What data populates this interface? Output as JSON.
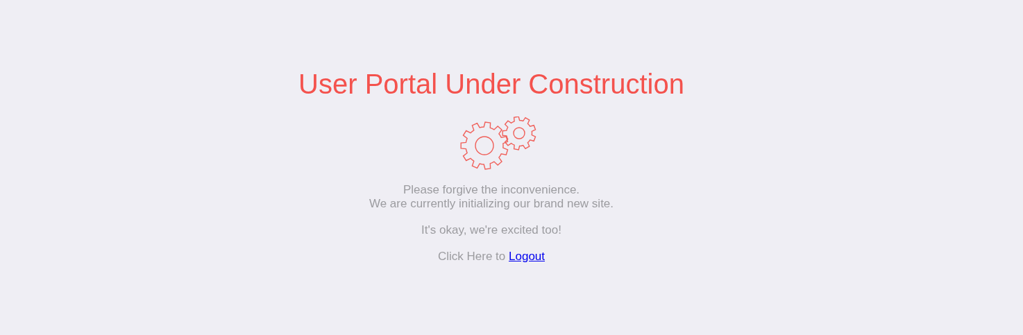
{
  "title": "User Portal Under Construction",
  "message_lines": [
    "Please forgive the inconvenience.",
    "We are currently initializing our brand new site."
  ],
  "excited": "It's okay, we're excited too!",
  "logout_prompt": {
    "text": "Click Here to",
    "link": "Logout"
  }
}
